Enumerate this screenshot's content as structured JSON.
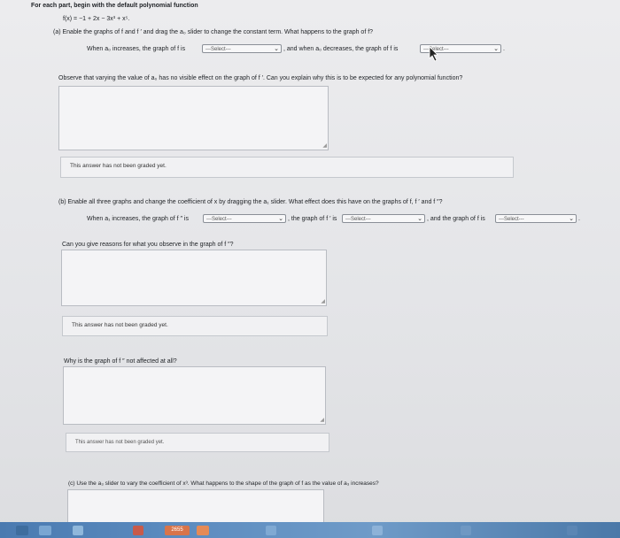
{
  "intro": {
    "heading": "For each part, begin with the default polynomial function",
    "function": "f(x) = −1 + 2x − 3x³ + x⁵."
  },
  "part_a": {
    "prompt": "(a) Enable the graphs of f and f ′ and drag the a₀ slider to change the constant term. What happens to the graph of f?",
    "when_increases": "When a₀ increases, the graph of f is",
    "and_when_decreases": ", and when a₀ decreases, the graph of f is",
    "select_1": "---Select---",
    "select_2": "---Select---",
    "observe": "Observe that varying the value of a₀ has no visible effect on the graph of f ′. Can you explain why this is to be expected for any polynomial function?",
    "feedback": "This answer has not been graded yet."
  },
  "part_b": {
    "prompt": "(b) Enable all three graphs and change the coefficient of x by dragging the a₁ slider. What effect does this have on the graphs of f, f ′ and f ″?",
    "when_increases": "When a₁ increases, the graph of f ″ is",
    "graph_of_fprime": ", the graph of f ′ is",
    "graph_of_f": ", and the graph of f is",
    "select_1": "---Select---",
    "select_2": "---Select---",
    "select_3": "---Select---",
    "question_1": "Can you give reasons for what you observe in the graph of f ″?",
    "feedback_1": "This answer has not been graded yet.",
    "question_2": "Why is the graph of f ″ not affected at all?",
    "feedback_2": "This answer has not been graded yet."
  },
  "part_c": {
    "prompt": "(c) Use the a₃ slider to vary the coefficient of x³. What happens to the shape of the graph of f as the value of a₃ increases?"
  },
  "taskbar": {
    "button_label": "2655"
  }
}
